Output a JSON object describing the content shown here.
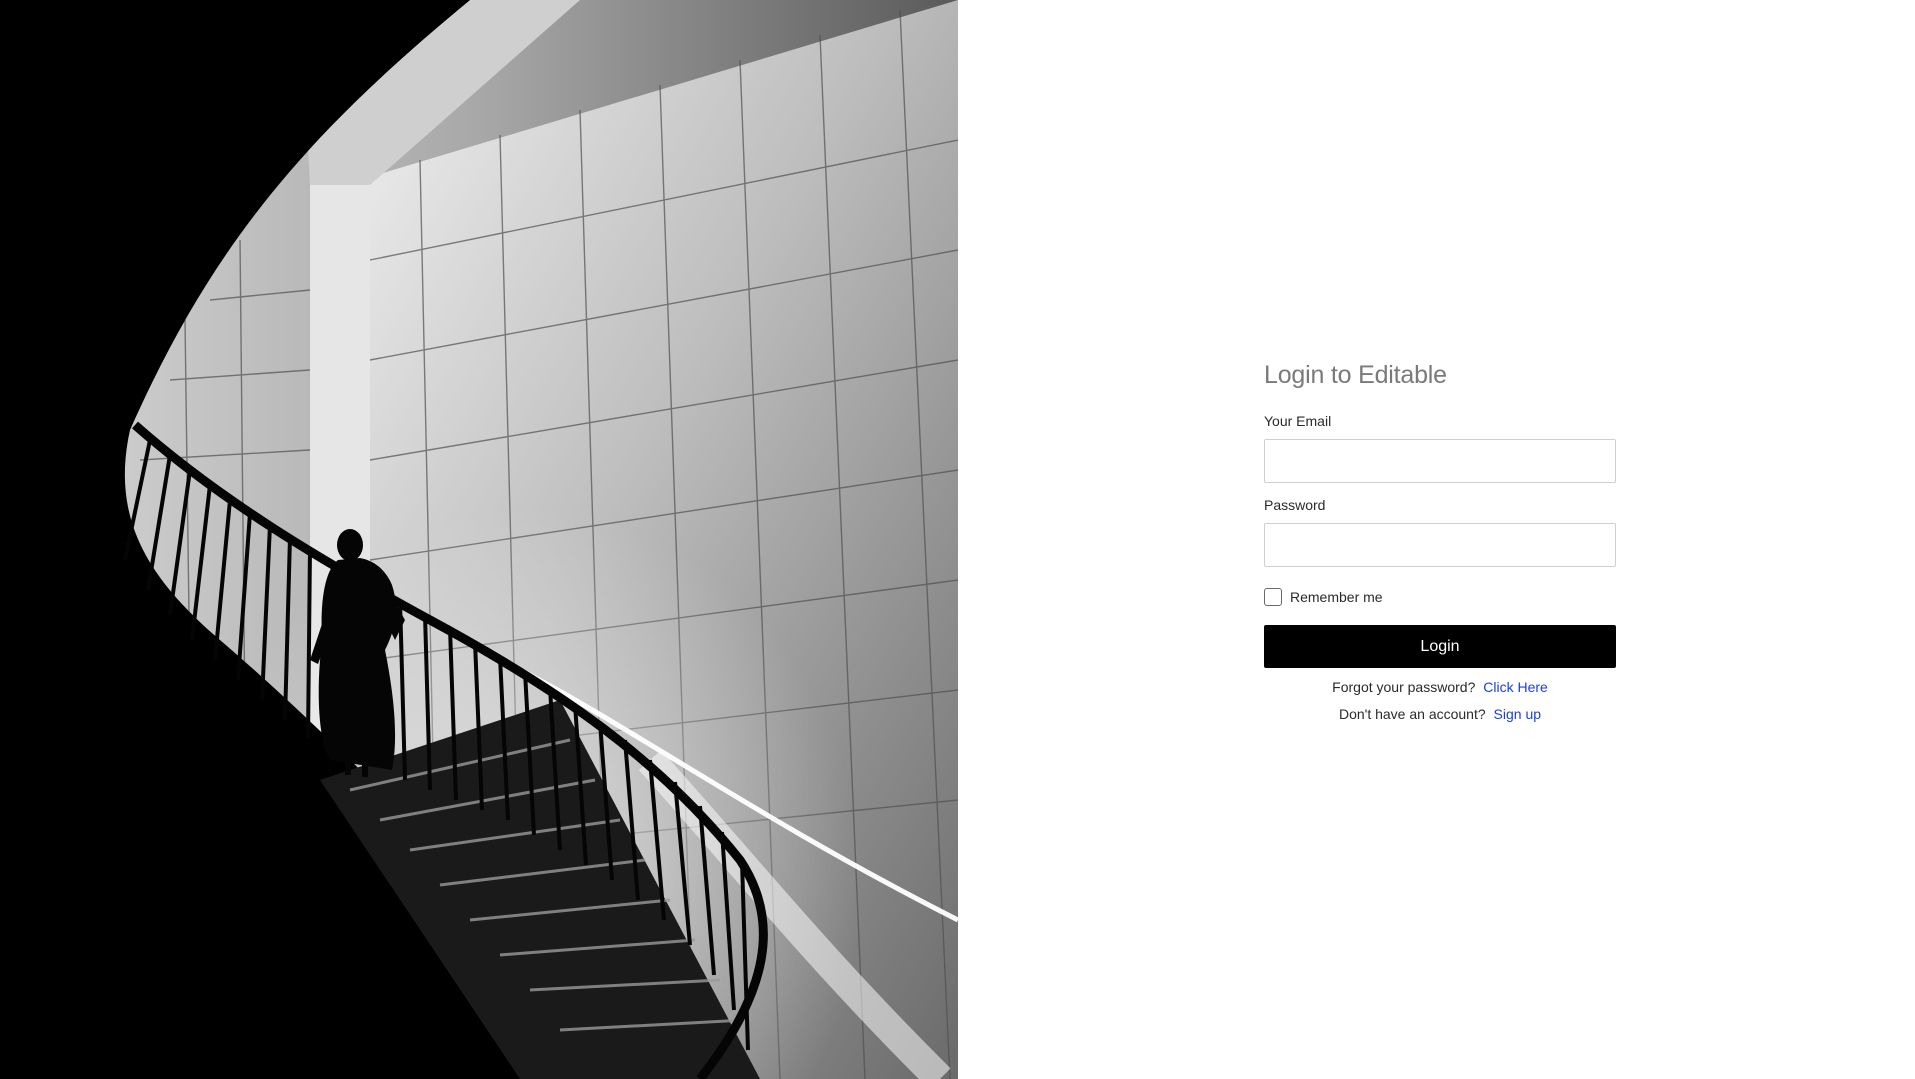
{
  "login": {
    "title": "Login to Editable",
    "email_label": "Your Email",
    "email_value": "",
    "password_label": "Password",
    "password_value": "",
    "remember_label": "Remember me",
    "remember_checked": false,
    "login_button": "Login",
    "forgot_text": "Forgot your password?",
    "forgot_link": "Click Here",
    "signup_text": "Don't have an account?",
    "signup_link": "Sign up"
  },
  "colors": {
    "button_bg": "#000000",
    "link": "#1a3fe0",
    "title": "#7a7a7a"
  }
}
